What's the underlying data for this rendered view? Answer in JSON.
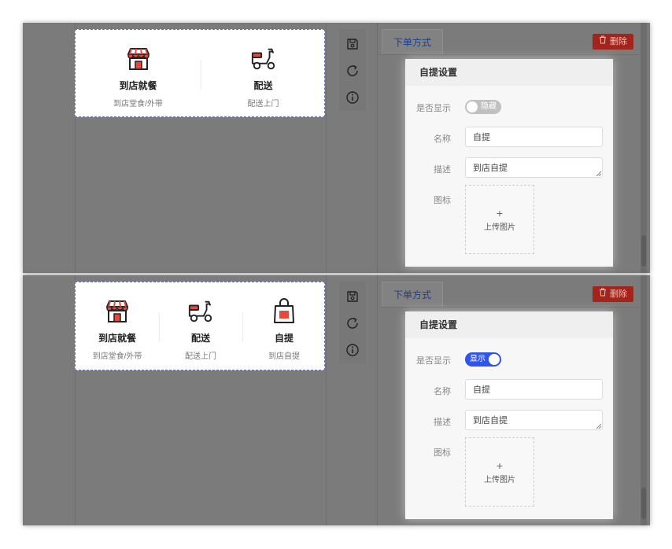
{
  "screens": [
    {
      "preview_items": [
        {
          "name": "到店就餐",
          "desc": "到店堂食/外带",
          "icon": "store-icon"
        },
        {
          "name": "配送",
          "desc": "配送上门",
          "icon": "scooter-icon"
        }
      ],
      "tab_label": "下单方式",
      "delete_label": "删除",
      "card_title": "自提设置",
      "show_label": "是否显示",
      "switch_text": "隐藏",
      "switch_state": "off",
      "name_label": "名称",
      "name_value": "自提",
      "desc_label": "描述",
      "desc_value": "到店自提",
      "icon_label": "图标",
      "upload_plus": "+",
      "upload_text": "上传图片"
    },
    {
      "preview_items": [
        {
          "name": "到店就餐",
          "desc": "到店堂食/外带",
          "icon": "store-icon"
        },
        {
          "name": "配送",
          "desc": "配送上门",
          "icon": "scooter-icon"
        },
        {
          "name": "自提",
          "desc": "到店自提",
          "icon": "shopping-bag-icon"
        }
      ],
      "tab_label": "下单方式",
      "delete_label": "删除",
      "card_title": "自提设置",
      "show_label": "是否显示",
      "switch_text": "显示",
      "switch_state": "on",
      "name_label": "名称",
      "name_value": "自提",
      "desc_label": "描述",
      "desc_value": "到店自提",
      "icon_label": "图标",
      "upload_plus": "+",
      "upload_text": "上传图片"
    }
  ],
  "colors": {
    "accent": "#2f54eb",
    "danger": "#a3241a",
    "tab_text": "#1d3f8c",
    "icon_red": "#e8473c"
  }
}
